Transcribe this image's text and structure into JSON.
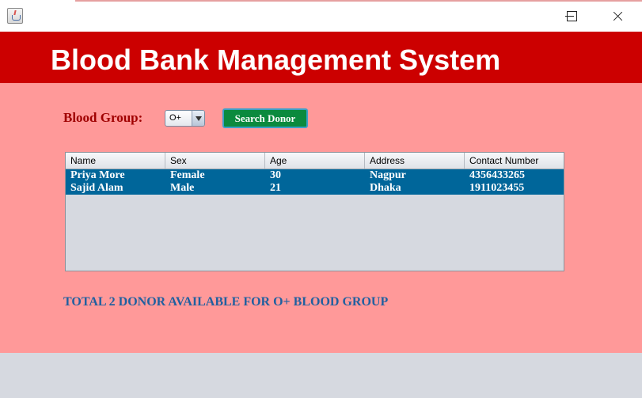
{
  "window": {
    "icon": "java-cup-icon",
    "controls": [
      "minimize",
      "maximize",
      "close"
    ]
  },
  "header": {
    "title": "Blood Bank Management System"
  },
  "search": {
    "label": "Blood Group:",
    "selected": "O+",
    "button": "Search Donor"
  },
  "table": {
    "columns": [
      "Name",
      "Sex",
      "Age",
      "Address",
      "Contact Number"
    ],
    "rows": [
      [
        "Priya More",
        "Female",
        "30",
        "Nagpur",
        "4356433265"
      ],
      [
        "Sajid Alam",
        "Male",
        "21",
        "Dhaka",
        "1911023455"
      ]
    ]
  },
  "summary": "TOTAL 2 DONOR AVAILABLE FOR O+ BLOOD GROUP",
  "colors": {
    "header_bg": "#cc0000",
    "panel_bg": "#ff9999",
    "selected_row": "#00669a",
    "button_bg": "#0b8a3e",
    "summary_text": "#2060a0"
  }
}
